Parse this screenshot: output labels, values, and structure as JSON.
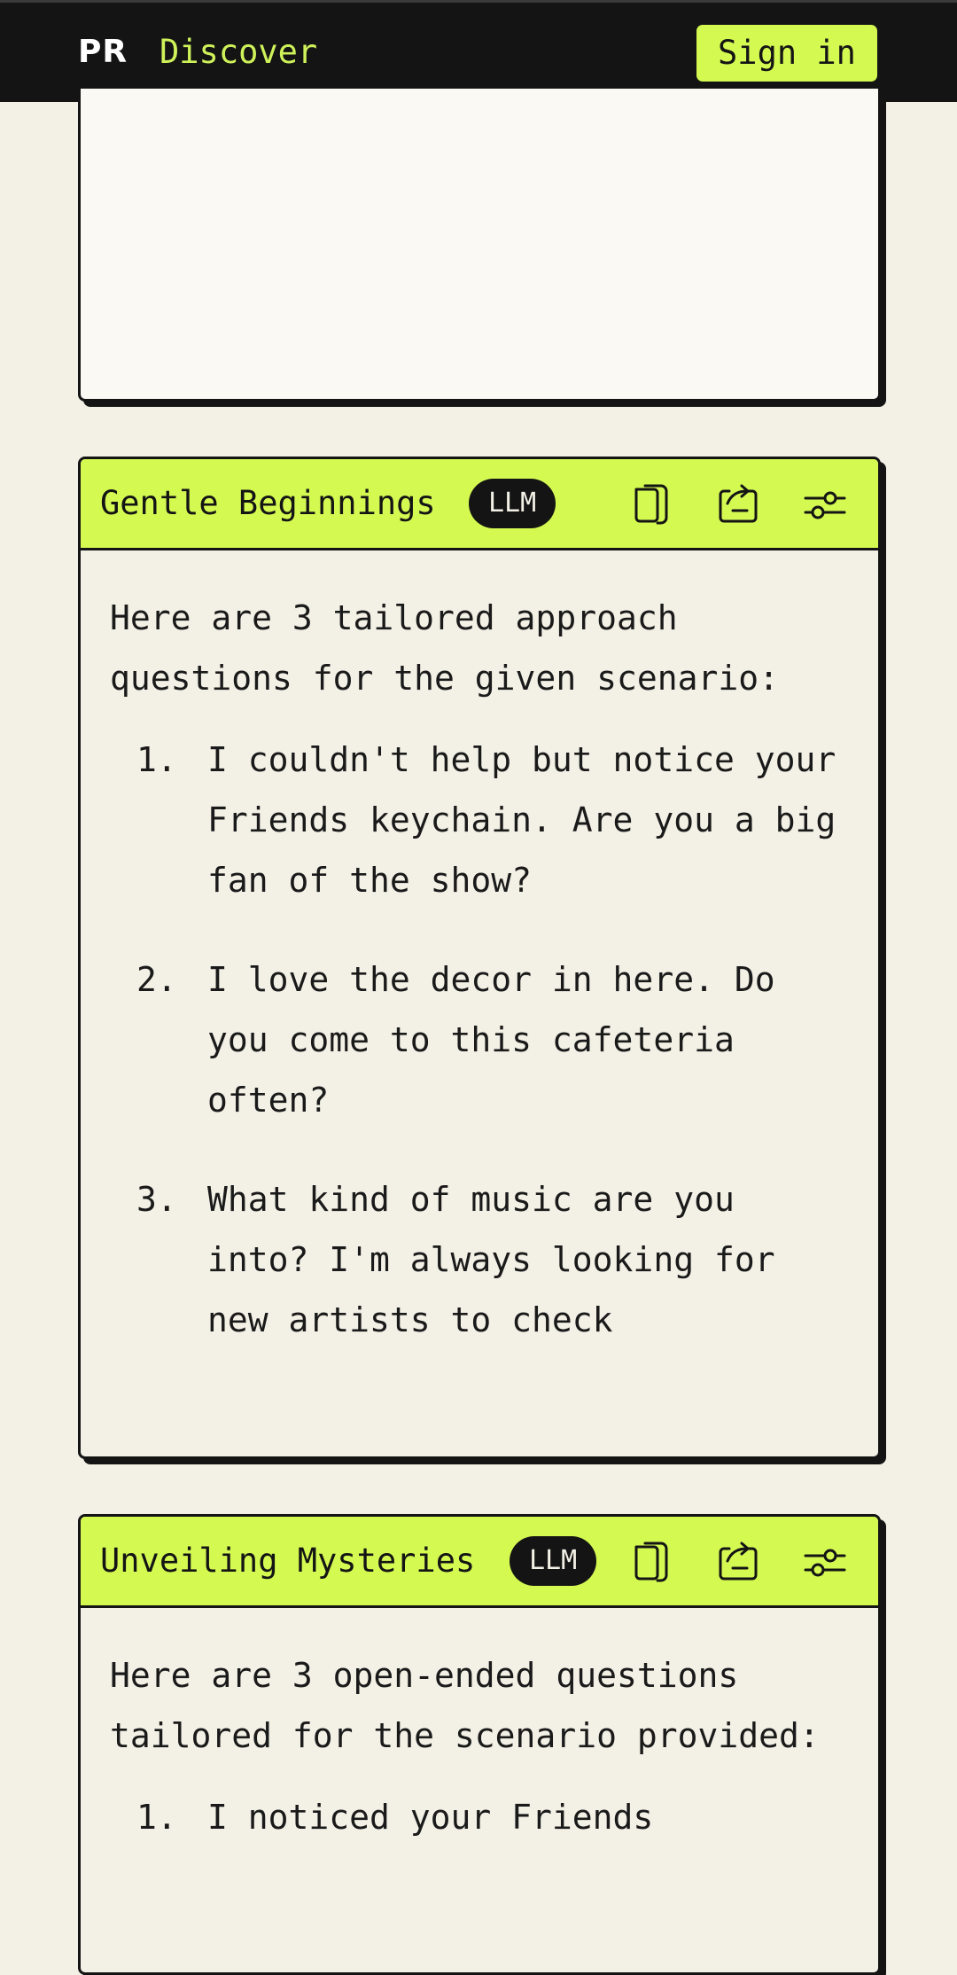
{
  "header": {
    "logo": "PR",
    "nav_discover": "Discover",
    "signin_label": "Sign in",
    "colors": {
      "bar": "#141414",
      "accent": "#d4fa52",
      "nav_text": "#cff25a"
    }
  },
  "cards": [
    {
      "title": "Gentle Beginnings",
      "badge": "LLM",
      "icons": [
        "copy-icon",
        "share-icon",
        "settings-sliders-icon"
      ],
      "intro": "Here are 3 tailored approach questions for the given scenario:",
      "items": [
        {
          "num": "1.",
          "text": "I couldn't help but notice your Friends keychain. Are you a big fan of the show?"
        },
        {
          "num": "2.",
          "text": "I love the decor in here. Do you come to this cafeteria often?"
        },
        {
          "num": "3.",
          "text": "What kind of music are you into? I'm always looking for new artists to check"
        }
      ]
    },
    {
      "title": "Unveiling Mysteries",
      "badge": "LLM",
      "icons": [
        "copy-icon",
        "share-icon",
        "settings-sliders-icon"
      ],
      "intro": "Here are 3 open-ended questions tailored for the scenario provided:",
      "items": [
        {
          "num": "1.",
          "text": "I noticed your Friends"
        }
      ]
    }
  ]
}
